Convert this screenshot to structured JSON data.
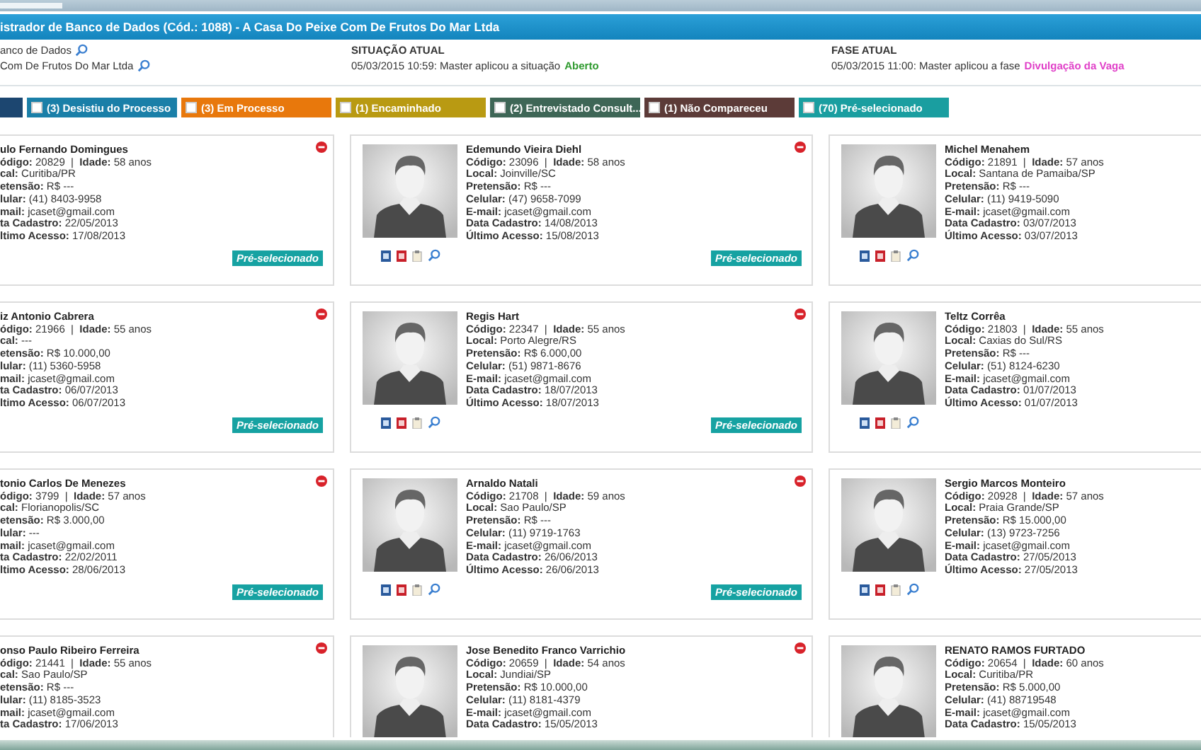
{
  "title_bar": {
    "title": "istrador de Banco de Dados (Cód.: 1088) - A Casa Do Peixe Com De Frutos Do Mar Ltda"
  },
  "info": {
    "links": [
      "anco de Dados",
      "Com De Frutos Do Mar Ltda"
    ],
    "situacao": {
      "heading": "SITUAÇÃO ATUAL",
      "text": "05/03/2015 10:59: Master aplicou a situação",
      "value": "Aberto",
      "color": "#2e9a2e"
    },
    "fase": {
      "heading": "FASE ATUAL",
      "text": "05/03/2015 11:00: Master aplicou a fase",
      "value": "Divulgação da Vaga",
      "color": "#e040c8"
    }
  },
  "filters": [
    {
      "color": "#1c4670"
    },
    {
      "label": "(3) Desistiu do Processo",
      "color": "#1a7fa8",
      "checked": false
    },
    {
      "label": "(3) Em Processo",
      "color": "#e8780c",
      "checked": false
    },
    {
      "label": "(1) Encaminhado",
      "color": "#b99a12",
      "checked": false
    },
    {
      "label": "(2) Entrevistado Consult...",
      "color": "#3e6656",
      "checked": false
    },
    {
      "label": "(1) Não Compareceu",
      "color": "#5c3b38",
      "checked": false
    },
    {
      "label": "(70) Pré-selecionado",
      "color": "#1a9ea0",
      "checked": false
    }
  ],
  "cards": [
    {
      "name": "ulo Fernando Domingues",
      "photo": false,
      "remove": true,
      "badge": "Pré-selecionado",
      "lines": [
        "**ódigo:** 20829  |  **Idade:** 58 anos",
        "**cal:** Curitiba/PR",
        "**etensão:** R$ ---",
        "**lular:** (41) 8403-9958",
        "**mail:** jcaset@gmail.com",
        "**ta Cadastro:** 22/05/2013",
        "**ltimo Acesso:** 17/08/2013"
      ]
    },
    {
      "name": "Edemundo Vieira Diehl",
      "photo": true,
      "remove": true,
      "badge": "Pré-selecionado",
      "lines": [
        "**Código:** 23096  |  **Idade:** 58 anos",
        "**Local:** Joinville/SC",
        "**Pretensão:** R$ ---",
        "**Celular:** (47) 9658-7099",
        "**E-mail:** jcaset@gmail.com",
        "**Data Cadastro:** 14/08/2013",
        "**Último Acesso:** 15/08/2013"
      ]
    },
    {
      "name": "Michel Menahem",
      "photo": true,
      "remove": false,
      "lines": [
        "**Código:** 21891  |  **Idade:** 57 anos",
        "**Local:** Santana de Pamaiba/SP",
        "**Pretensão:** R$ ---",
        "**Celular:** (11) 9419-5090",
        "**E-mail:** jcaset@gmail.com",
        "**Data Cadastro:** 03/07/2013",
        "**Último Acesso:** 03/07/2013"
      ]
    },
    {
      "name": "iz Antonio Cabrera",
      "photo": false,
      "remove": true,
      "badge": "Pré-selecionado",
      "lines": [
        "**ódigo:** 21966  |  **Idade:** 55 anos",
        "**cal:** ---",
        "**etensão:** R$ 10.000,00",
        "**lular:** (11) 5360-5958",
        "**mail:** jcaset@gmail.com",
        "**ta Cadastro:** 06/07/2013",
        "**ltimo Acesso:** 06/07/2013"
      ]
    },
    {
      "name": "Regis Hart",
      "photo": true,
      "remove": true,
      "badge": "Pré-selecionado",
      "lines": [
        "**Código:** 22347  |  **Idade:** 55 anos",
        "**Local:** Porto Alegre/RS",
        "**Pretensão:** R$ 6.000,00",
        "**Celular:** (51) 9871-8676",
        "**E-mail:** jcaset@gmail.com",
        "**Data Cadastro:** 18/07/2013",
        "**Último Acesso:** 18/07/2013"
      ]
    },
    {
      "name": "Teltz Corrêa",
      "photo": true,
      "remove": false,
      "lines": [
        "**Código:** 21803  |  **Idade:** 55 anos",
        "**Local:** Caxias do Sul/RS",
        "**Pretensão:** R$ ---",
        "**Celular:** (51) 8124-6230",
        "**E-mail:** jcaset@gmail.com",
        "**Data Cadastro:** 01/07/2013",
        "**Último Acesso:** 01/07/2013"
      ]
    },
    {
      "name": "tonio Carlos De Menezes",
      "photo": false,
      "remove": true,
      "badge": "Pré-selecionado",
      "lines": [
        "**ódigo:** 3799  |  **Idade:** 57 anos",
        "**cal:** Florianopolis/SC",
        "**etensão:** R$ 3.000,00",
        "**lular:** ---",
        "**mail:** jcaset@gmail.com",
        "**ta Cadastro:** 22/02/2011",
        "**ltimo Acesso:** 28/06/2013"
      ]
    },
    {
      "name": "Arnaldo Natali",
      "photo": true,
      "remove": true,
      "badge": "Pré-selecionado",
      "lines": [
        "**Código:** 21708  |  **Idade:** 59 anos",
        "**Local:** Sao Paulo/SP",
        "**Pretensão:** R$ ---",
        "**Celular:** (11) 9719-1763",
        "**E-mail:** jcaset@gmail.com",
        "**Data Cadastro:** 26/06/2013",
        "**Último Acesso:** 26/06/2013"
      ]
    },
    {
      "name": "Sergio Marcos Monteiro",
      "photo": true,
      "remove": false,
      "lines": [
        "**Código:** 20928  |  **Idade:** 57 anos",
        "**Local:** Praia Grande/SP",
        "**Pretensão:** R$ 15.000,00",
        "**Celular:** (13) 9723-7256",
        "**E-mail:** jcaset@gmail.com",
        "**Data Cadastro:** 27/05/2013",
        "**Último Acesso:** 27/05/2013"
      ]
    },
    {
      "name": "onso Paulo Ribeiro Ferreira",
      "photo": false,
      "remove": true,
      "lines": [
        "**ódigo:** 21441  |  **Idade:** 55 anos",
        "**cal:** Sao Paulo/SP",
        "**etensão:** R$ ---",
        "**lular:** (11) 8185-3523",
        "**mail:** jcaset@gmail.com",
        "**ta Cadastro:** 17/06/2013"
      ]
    },
    {
      "name": "Jose Benedito Franco Varrichio",
      "photo": true,
      "remove": true,
      "lines": [
        "**Código:** 20659  |  **Idade:** 54 anos",
        "**Local:** Jundiai/SP",
        "**Pretensão:** R$ 10.000,00",
        "**Celular:** (11) 8181-4379",
        "**E-mail:** jcaset@gmail.com",
        "**Data Cadastro:** 15/05/2013"
      ]
    },
    {
      "name": "RENATO RAMOS FURTADO",
      "photo": true,
      "remove": false,
      "lines": [
        "**Código:** 20654  |  **Idade:** 60 anos",
        "**Local:** Curitiba/PR",
        "**Pretensão:** R$ 5.000,00",
        "**Celular:** (41) 88719548",
        "**E-mail:** jcaset@gmail.com",
        "**Data Cadastro:** 15/05/2013"
      ]
    }
  ]
}
